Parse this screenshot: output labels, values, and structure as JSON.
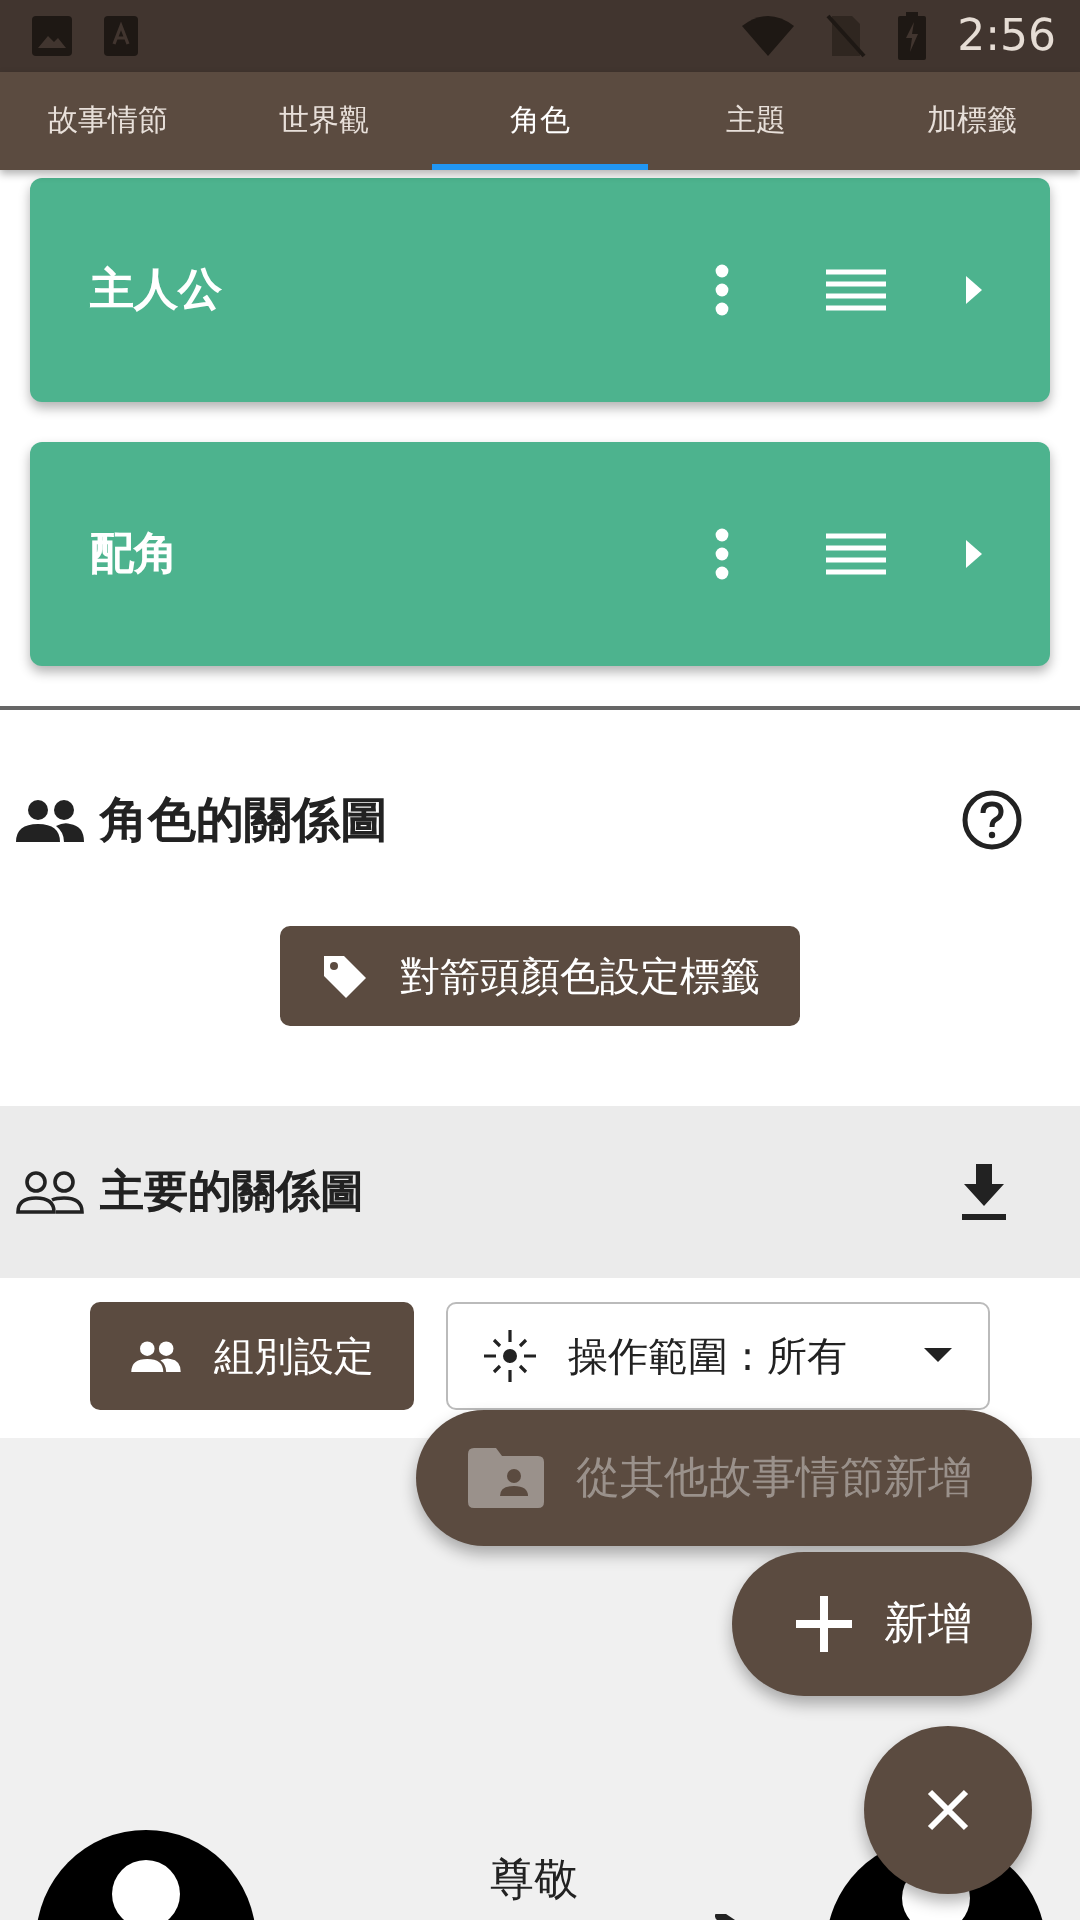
{
  "status_bar": {
    "time": "2:56"
  },
  "tabs": [
    {
      "label": "故事情節",
      "selected": false
    },
    {
      "label": "世界觀",
      "selected": false
    },
    {
      "label": "角色",
      "selected": true
    },
    {
      "label": "主題",
      "selected": false
    },
    {
      "label": "加標籤",
      "selected": false
    }
  ],
  "character_groups": [
    {
      "name": "主人公"
    },
    {
      "name": "配角"
    }
  ],
  "relationship_section": {
    "title": "角色的關係圖",
    "tag_button": "對箭頭顏色設定標籤"
  },
  "main_diagram": {
    "title": "主要的關係圖",
    "group_button": "組別設定",
    "scope_dropdown": "操作範圍 : 所有"
  },
  "diagram": {
    "edges": [
      {
        "label": "尊敬"
      }
    ]
  },
  "fab_menu": [
    {
      "kind": "import",
      "label": "從其他故事情節新增",
      "disabled": true
    },
    {
      "kind": "add",
      "label": "新增",
      "disabled": false
    }
  ]
}
